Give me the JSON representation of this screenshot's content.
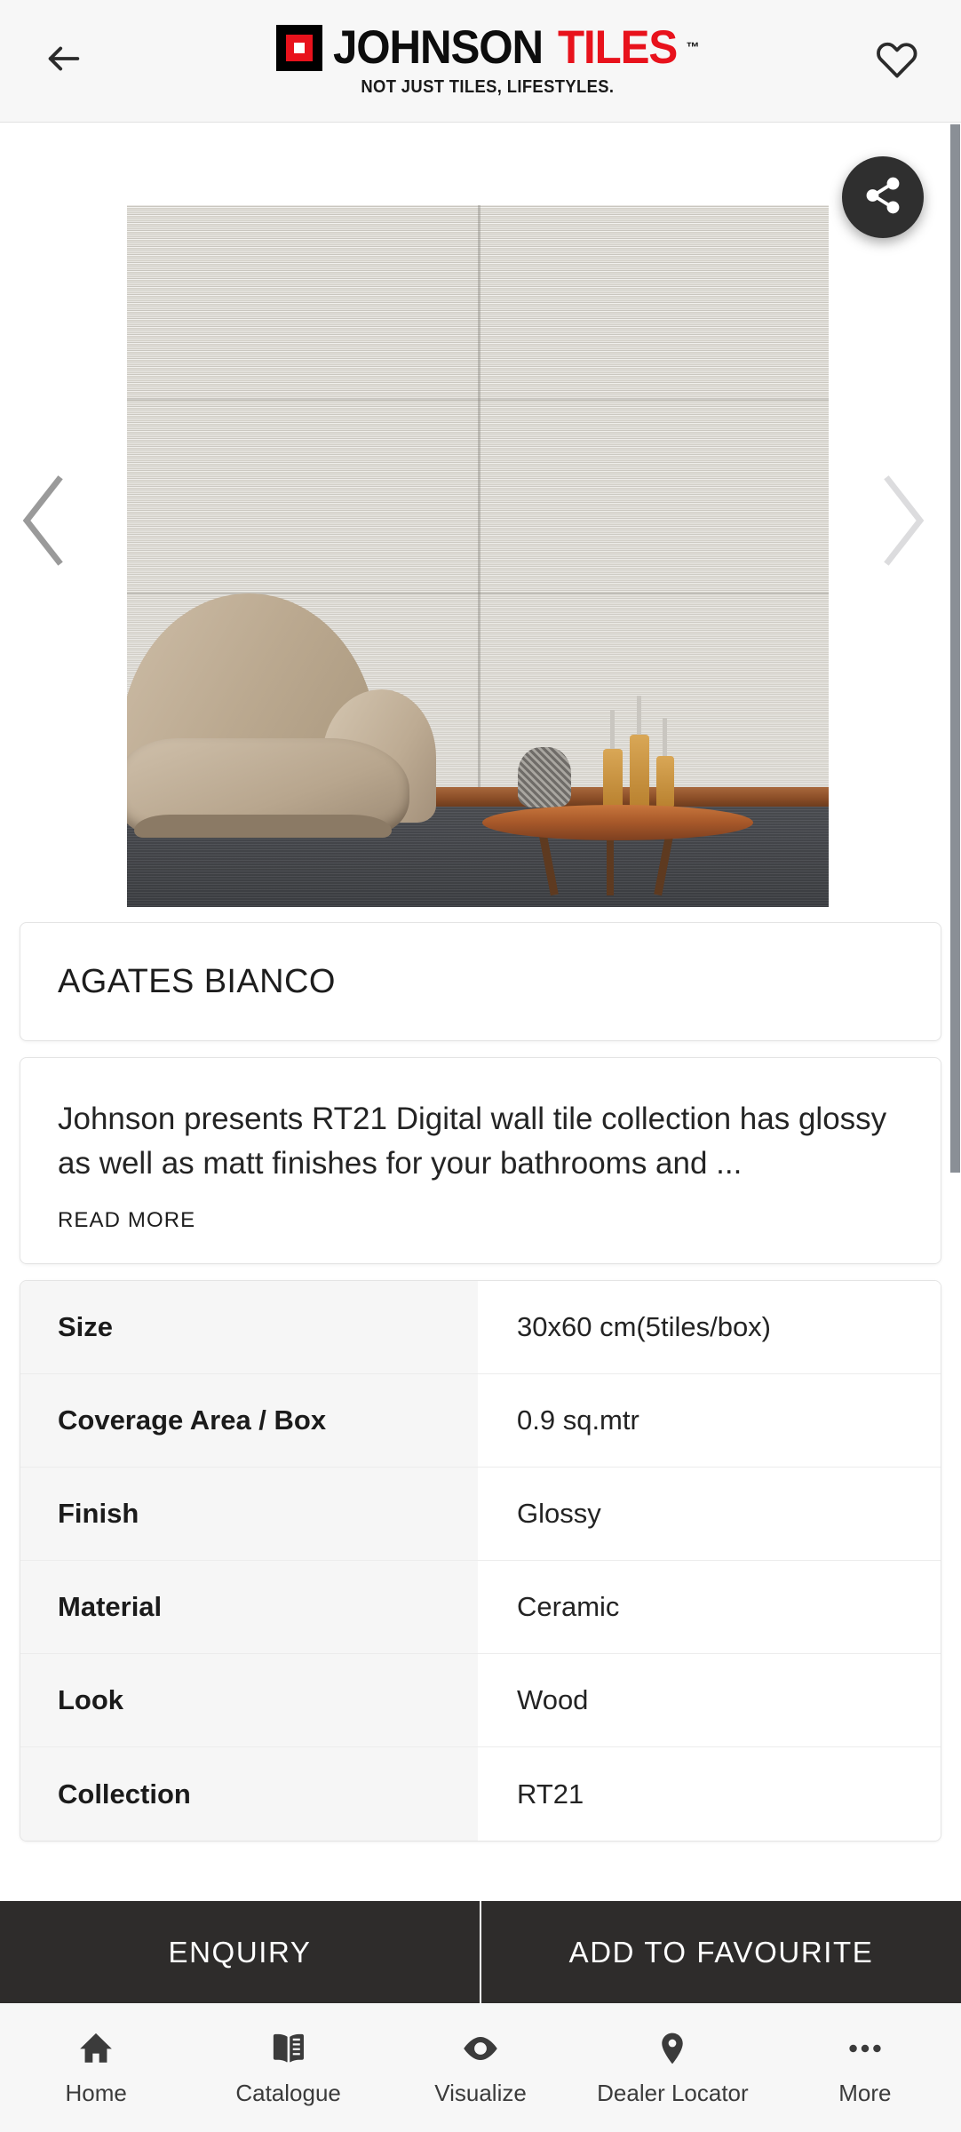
{
  "header": {
    "back_icon": "arrow-left-icon",
    "favourite_icon": "heart-outline-icon",
    "logo": {
      "brand_primary": "JOHNSON",
      "brand_secondary": "TILES",
      "trademark": "™",
      "tagline": "NOT JUST TILES, LIFESTYLES.",
      "mark_color_outer": "#000000",
      "mark_color_inner": "#e8121c",
      "mark_color_core": "#ffffff",
      "tiles_color": "#e8121c"
    }
  },
  "carousel": {
    "prev_icon": "chevron-left-icon",
    "next_icon": "chevron-right-icon",
    "share_icon": "share-icon",
    "image_alt": "Agates Bianco wall tile room scene with armchair and side table"
  },
  "product": {
    "title": "AGATES BIANCO",
    "description": "Johnson presents RT21 Digital wall tile collection has glossy as well as matt finishes for your bathrooms and ...",
    "read_more_label": "READ MORE"
  },
  "specs": {
    "rows": [
      {
        "label": "Size",
        "value": "30x60 cm(5tiles/box)"
      },
      {
        "label": "Coverage Area / Box",
        "value": "0.9 sq.mtr"
      },
      {
        "label": "Finish",
        "value": "Glossy"
      },
      {
        "label": "Material",
        "value": "Ceramic"
      },
      {
        "label": "Look",
        "value": "Wood"
      },
      {
        "label": "Collection",
        "value": "RT21"
      }
    ]
  },
  "actions": {
    "enquiry_label": "ENQUIRY",
    "favourite_label": "ADD TO FAVOURITE",
    "bar_color": "#2e2c2b"
  },
  "bottom_nav": {
    "items": [
      {
        "label": "Home",
        "icon": "home-icon"
      },
      {
        "label": "Catalogue",
        "icon": "book-icon"
      },
      {
        "label": "Visualize",
        "icon": "eye-icon"
      },
      {
        "label": "Dealer Locator",
        "icon": "map-pin-icon"
      },
      {
        "label": "More",
        "icon": "ellipsis-icon"
      }
    ]
  },
  "scrollbar": {
    "thumb_color": "#8a8f96"
  }
}
